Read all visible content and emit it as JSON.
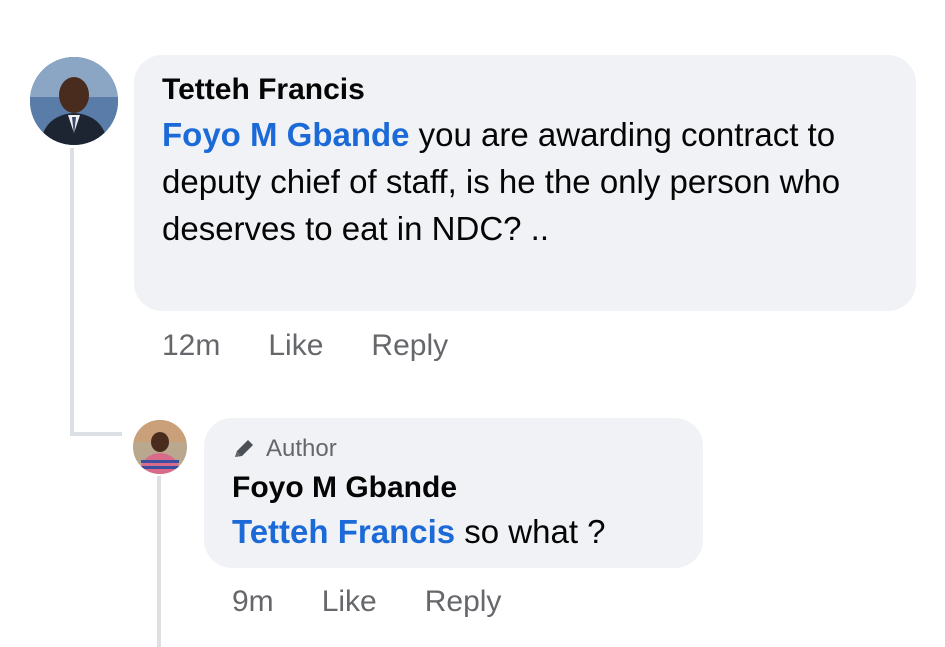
{
  "comments": [
    {
      "author": "Tetteh Francis",
      "mention": "Foyo M Gbande",
      "text": " you are awarding contract to deputy chief of staff, is he the only person who deserves to eat in NDC? ..",
      "time": "12m",
      "like": "Like",
      "reply": "Reply"
    }
  ],
  "replies": [
    {
      "badge": "Author",
      "author": "Foyo M Gbande",
      "mention": "Tetteh Francis",
      "text": " so what ?",
      "time": "9m",
      "like": "Like",
      "reply": "Reply"
    }
  ],
  "icons": {
    "author_badge": "pencil-icon"
  },
  "colors": {
    "mention": "#1b6ad8",
    "bubble": "#f0f2f5",
    "meta": "#65676b"
  }
}
